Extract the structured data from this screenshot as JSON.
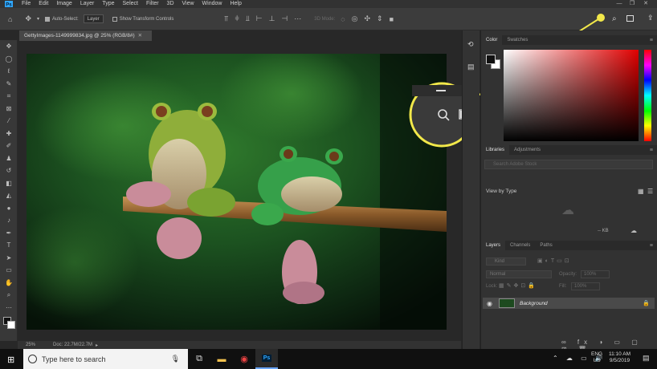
{
  "menu": [
    "File",
    "Edit",
    "Image",
    "Layer",
    "Type",
    "Select",
    "Filter",
    "3D",
    "View",
    "Window",
    "Help"
  ],
  "options_bar": {
    "auto_select_label": "Auto-Select:",
    "auto_select_value": "Layer",
    "show_transform_label": "Show Transform Controls",
    "mode_3d_label": "3D Mode:"
  },
  "document": {
    "tab_title": "GettyImages-1149999834.jpg @ 25% (RGB/8#)",
    "zoom": "25%",
    "doc_info": "Doc: 22.7M/22.7M"
  },
  "panels": {
    "color_tabs": [
      "Color",
      "Swatches"
    ],
    "library_tabs": [
      "Libraries",
      "Adjustments"
    ],
    "library_search_placeholder": "Search Adobe Stock",
    "view_by": "View by Type",
    "library_size": "-- KB",
    "layers_tabs": [
      "Layers",
      "Channels",
      "Paths"
    ],
    "kind_label": "Kind",
    "blend_mode": "Normal",
    "opacity_label": "Opacity:",
    "opacity_value": "100%",
    "lock_label": "Lock:",
    "fill_label": "Fill:",
    "fill_value": "100%",
    "layer_name": "Background"
  },
  "taskbar": {
    "search_placeholder": "Type here to search",
    "lang_top": "ENG",
    "lang_bottom": "US",
    "time": "11:10 AM",
    "date": "9/5/2019"
  },
  "colors": {
    "callout": "#f2e84a",
    "ps_blue": "#31a8ff"
  }
}
